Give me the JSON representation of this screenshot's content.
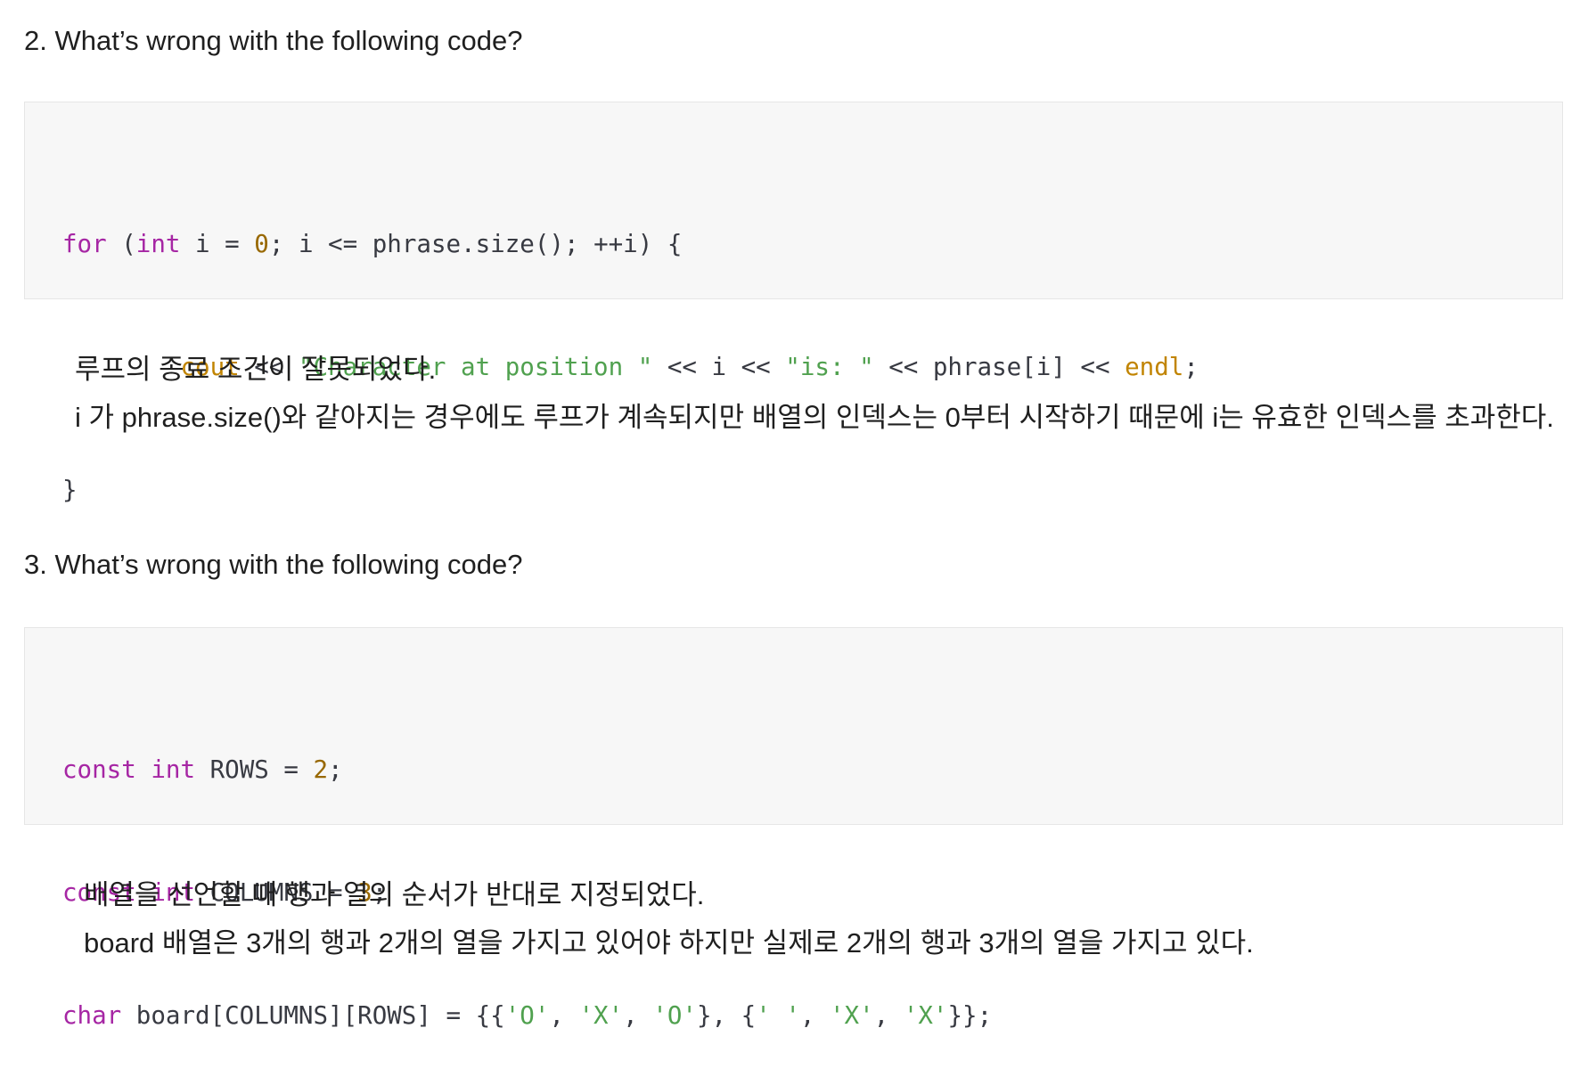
{
  "q2": {
    "title": "2. What’s wrong with the following code?",
    "code": [
      [
        {
          "t": "for",
          "c": "kw"
        },
        {
          "t": " (",
          "c": "plain"
        },
        {
          "t": "int",
          "c": "kw"
        },
        {
          "t": " i = ",
          "c": "plain"
        },
        {
          "t": "0",
          "c": "num"
        },
        {
          "t": "; i <= phrase.size(); ++i) {",
          "c": "plain"
        }
      ],
      [
        {
          "t": "        ",
          "c": "plain"
        },
        {
          "t": "cout",
          "c": "fn"
        },
        {
          "t": " << ",
          "c": "plain"
        },
        {
          "t": "\"Character at position \"",
          "c": "str"
        },
        {
          "t": " << i << ",
          "c": "plain"
        },
        {
          "t": "\"is: \"",
          "c": "str"
        },
        {
          "t": " << phrase[i] << ",
          "c": "plain"
        },
        {
          "t": "endl",
          "c": "fn"
        },
        {
          "t": ";",
          "c": "plain"
        }
      ],
      [
        {
          "t": "}",
          "c": "plain"
        }
      ]
    ],
    "answer": [
      "루프의 종료 조건이 잘못되었다.",
      "i 가 phrase.size()와 같아지는 경우에도 루프가 계속되지만 배열의 인덱스는 0부터 시작하기 때문에 i는 유효한 인덱스를 초과한다."
    ]
  },
  "q3": {
    "title": "3. What’s wrong with the following code?",
    "code": [
      [
        {
          "t": "const",
          "c": "kw"
        },
        {
          "t": " ",
          "c": "plain"
        },
        {
          "t": "int",
          "c": "kw"
        },
        {
          "t": " ROWS = ",
          "c": "plain"
        },
        {
          "t": "2",
          "c": "num"
        },
        {
          "t": ";",
          "c": "plain"
        }
      ],
      [
        {
          "t": "const",
          "c": "kw"
        },
        {
          "t": " ",
          "c": "plain"
        },
        {
          "t": "int",
          "c": "kw"
        },
        {
          "t": " COLUMNS = ",
          "c": "plain"
        },
        {
          "t": "3",
          "c": "num"
        },
        {
          "t": ";",
          "c": "plain"
        }
      ],
      [
        {
          "t": "char",
          "c": "kw"
        },
        {
          "t": " board[COLUMNS][ROWS] = {{",
          "c": "plain"
        },
        {
          "t": "'O'",
          "c": "str"
        },
        {
          "t": ", ",
          "c": "plain"
        },
        {
          "t": "'X'",
          "c": "str"
        },
        {
          "t": ", ",
          "c": "plain"
        },
        {
          "t": "'O'",
          "c": "str"
        },
        {
          "t": "}, {",
          "c": "plain"
        },
        {
          "t": "' '",
          "c": "str"
        },
        {
          "t": ", ",
          "c": "plain"
        },
        {
          "t": "'X'",
          "c": "str"
        },
        {
          "t": ", ",
          "c": "plain"
        },
        {
          "t": "'X'",
          "c": "str"
        },
        {
          "t": "}};",
          "c": "plain"
        }
      ]
    ],
    "answer": [
      "배열을 선언할 때 행과 열의 순서가 반대로 지정되었다.",
      "board 배열은 3개의 행과 2개의 열을 가지고 있어야 하지만 실제로 2개의 행과 3개의 열을 가지고 있다."
    ]
  }
}
